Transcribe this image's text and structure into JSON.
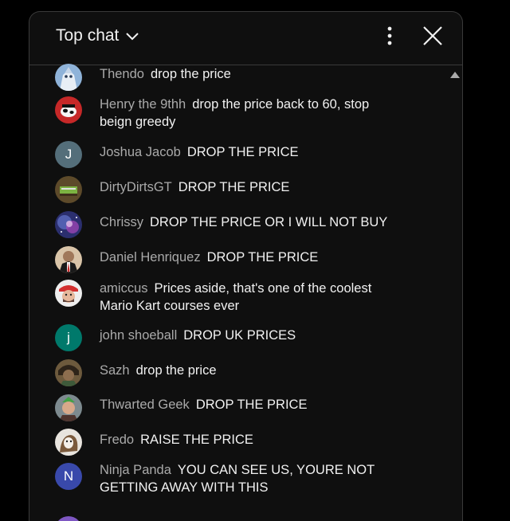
{
  "header": {
    "title": "Top chat",
    "chevron_icon": "chevron-down-icon",
    "menu_icon": "more-vert-icon",
    "close_icon": "close-icon"
  },
  "colors": {
    "background": "#0f0f0f",
    "border": "#3a3a3a",
    "text": "#f1f1f1",
    "author": "#aaaaaa"
  },
  "messages": [
    {
      "author": "Thendo",
      "text": "drop the price",
      "avatar": "photo"
    },
    {
      "author": "Henry the 9thh",
      "text": "drop the price back to 60, stop beign greedy",
      "avatar": "photo"
    },
    {
      "author": "Joshua Jacob",
      "text": "DROP THE PRICE",
      "avatar": "letter",
      "initial": "J",
      "avatar_color": "#546e7a"
    },
    {
      "author": "DirtyDirtsGT",
      "text": "DROP THE PRICE",
      "avatar": "photo"
    },
    {
      "author": "Chrissy",
      "text": "DROP THE PRICE OR I WILL NOT BUY",
      "avatar": "photo"
    },
    {
      "author": "Daniel Henriquez",
      "text": "DROP THE PRICE",
      "avatar": "photo"
    },
    {
      "author": "amiccus",
      "text": "Prices aside, that's one of the coolest Mario Kart courses ever",
      "avatar": "photo"
    },
    {
      "author": "john shoeball",
      "text": "DROP UK PRICES",
      "avatar": "letter",
      "initial": "j",
      "avatar_color": "#00796b"
    },
    {
      "author": "Sazh",
      "text": "drop the price",
      "avatar": "photo"
    },
    {
      "author": "Thwarted Geek",
      "text": "DROP THE PRICE",
      "avatar": "photo"
    },
    {
      "author": "Fredo",
      "text": "RAISE THE PRICE",
      "avatar": "photo"
    },
    {
      "author": "Ninja Panda",
      "text": "YOU CAN SEE US, YOURE NOT GETTING AWAY WITH THIS",
      "avatar": "letter",
      "initial": "N",
      "avatar_color": "#3949ab"
    }
  ]
}
